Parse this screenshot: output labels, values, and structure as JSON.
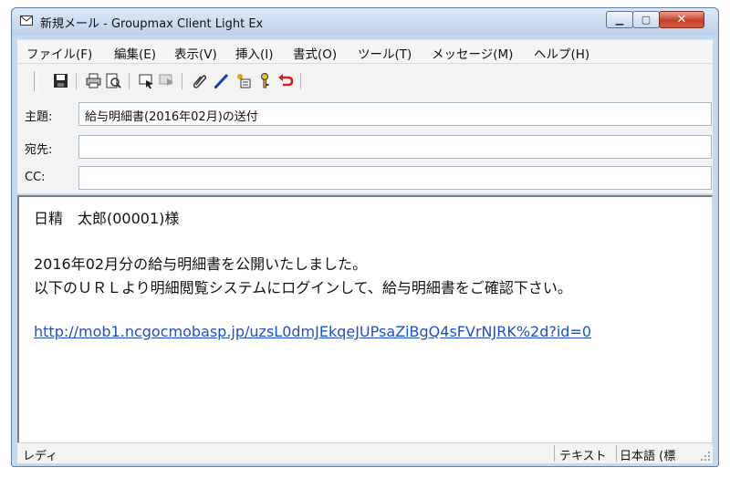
{
  "window": {
    "title": "新規メール - Groupmax Client Light Ex",
    "title_icon": "envelope-icon"
  },
  "window_controls": {
    "minimize": "minimize-icon",
    "maximize": "maximize-icon",
    "close": "close-icon"
  },
  "menu": {
    "items": [
      {
        "label": "ファイル(F)"
      },
      {
        "label": "編集(E)"
      },
      {
        "label": "表示(V)"
      },
      {
        "label": "挿入(I)"
      },
      {
        "label": "書式(O)"
      },
      {
        "label": "ツール(T)"
      },
      {
        "label": "メッセージ(M)"
      },
      {
        "label": "ヘルプ(H)"
      }
    ]
  },
  "toolbar": {
    "icons": [
      "save-icon",
      "print-icon",
      "print-preview-icon",
      "send-icon",
      "send-later-icon",
      "attach-icon",
      "pen-icon",
      "address-icon",
      "key-icon",
      "undo-icon"
    ]
  },
  "fields": {
    "subject": {
      "label": "主題:",
      "value": "給与明細書(2016年02月)の送付"
    },
    "to": {
      "label": "宛先:",
      "value": ""
    },
    "cc": {
      "label": "CC:",
      "value": ""
    }
  },
  "body": {
    "greeting": "日精　太郎(00001)様",
    "line1": "2016年02月分の給与明細書を公開いたしました。",
    "line2": "以下のＵＲＬより明細閲覧システムにログインして、給与明細書をご確認下さい。",
    "link": "http://mob1.ncgocmobasp.jp/uzsL0dmJEkqeJUPsaZiBgQ4sFVrNJRK%2d?id=0"
  },
  "status": {
    "left": "レディ",
    "format": "テキスト",
    "language": "日本語 (標"
  },
  "colors": {
    "link": "#1f4fc9",
    "close_button": "#c2402a",
    "titlebar": "#c6d8ee"
  }
}
